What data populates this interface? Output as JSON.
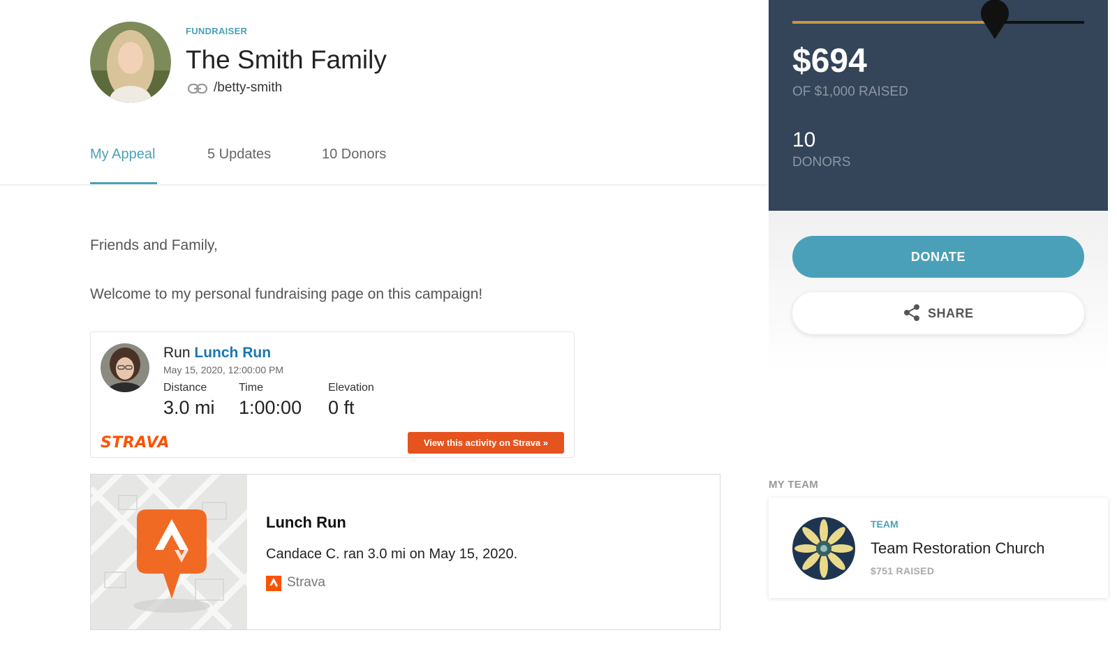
{
  "header": {
    "label": "FUNDRAISER",
    "title": "The Smith Family",
    "slug": "/betty-smith"
  },
  "tabs": [
    {
      "label": "My Appeal",
      "active": true
    },
    {
      "label": "5 Updates",
      "active": false
    },
    {
      "label": "10 Donors",
      "active": false
    }
  ],
  "appeal": {
    "greeting": "Friends and Family,",
    "welcome": "Welcome to my personal fundraising page on this campaign!"
  },
  "strava_card": {
    "activity_type": "Run",
    "activity_name": "Lunch Run",
    "date": "May 15, 2020, 12:00:00 PM",
    "stats": [
      {
        "label": "Distance",
        "value": "3.0 mi"
      },
      {
        "label": "Time",
        "value": "1:00:00"
      },
      {
        "label": "Elevation",
        "value": "0 ft"
      }
    ],
    "logo_text": "STRAVA",
    "button_label": "View this activity on Strava »"
  },
  "preview_card": {
    "title": "Lunch Run",
    "description": "Candace C. ran 3.0 mi on May 15, 2020.",
    "source": "Strava"
  },
  "stats": {
    "amount": "$694",
    "raised_label": "OF $1,000 RAISED",
    "progress_fraction": 0.694,
    "donor_count": "10",
    "donor_label": "DONORS"
  },
  "actions": {
    "donate_label": "DONATE",
    "share_label": "SHARE"
  },
  "team": {
    "heading": "MY TEAM",
    "label": "TEAM",
    "name": "Team Restoration Church",
    "raised": "$751 RAISED"
  },
  "colors": {
    "accent": "#4aa0b8",
    "panel": "#344459",
    "progress": "#c7963b",
    "strava": "#fc5200"
  },
  "icons": [
    "link-icon",
    "share-icon",
    "strava-app-icon",
    "map-pin-icon"
  ]
}
